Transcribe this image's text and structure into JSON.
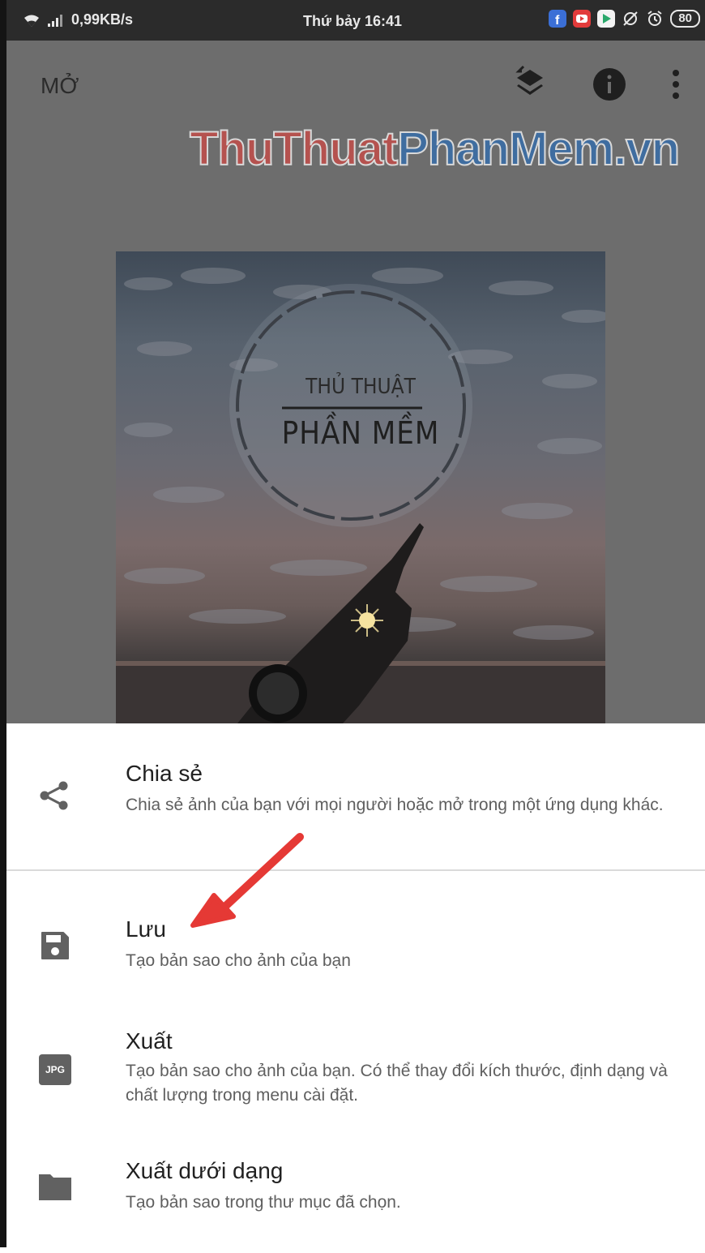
{
  "status_bar": {
    "network_speed": "0,99KB/s",
    "time": "Thứ bảy 16:41",
    "battery": "80",
    "icons": [
      "wifi-icon",
      "signal-icon",
      "facebook-icon",
      "youtube-icon",
      "play-store-icon",
      "sync-off-icon",
      "alarm-icon",
      "battery-icon"
    ]
  },
  "app_bar": {
    "title": "MỞ",
    "actions": [
      "layers-icon",
      "info-icon",
      "more-vert-icon"
    ]
  },
  "watermark": {
    "part1": "ThuThuat",
    "part2": "PhanMem.vn"
  },
  "photo": {
    "line1": "THỦ THUẬT",
    "line2": "PHẦN MỀM"
  },
  "sheet": {
    "items": [
      {
        "icon": "share-icon",
        "title": "Chia sẻ",
        "description": "Chia sẻ ảnh của bạn với mọi người hoặc mở trong một ứng dụng khác."
      },
      {
        "icon": "save-icon",
        "title": "Lưu",
        "description": "Tạo bản sao cho ảnh của bạn"
      },
      {
        "icon": "jpg-icon",
        "icon_label": "JPG",
        "title": "Xuất",
        "description": "Tạo bản sao cho ảnh của bạn. Có thể thay đổi kích thước, định dạng và chất lượng trong menu cài đặt."
      },
      {
        "icon": "folder-icon",
        "title": "Xuất dưới dạng",
        "description": "Tạo bản sao trong thư mục đã chọn."
      }
    ]
  },
  "colors": {
    "overlay": "#6d6d6d",
    "status_bar": "#2b2b2b",
    "arrow": "#e53935",
    "icon": "#616161"
  }
}
